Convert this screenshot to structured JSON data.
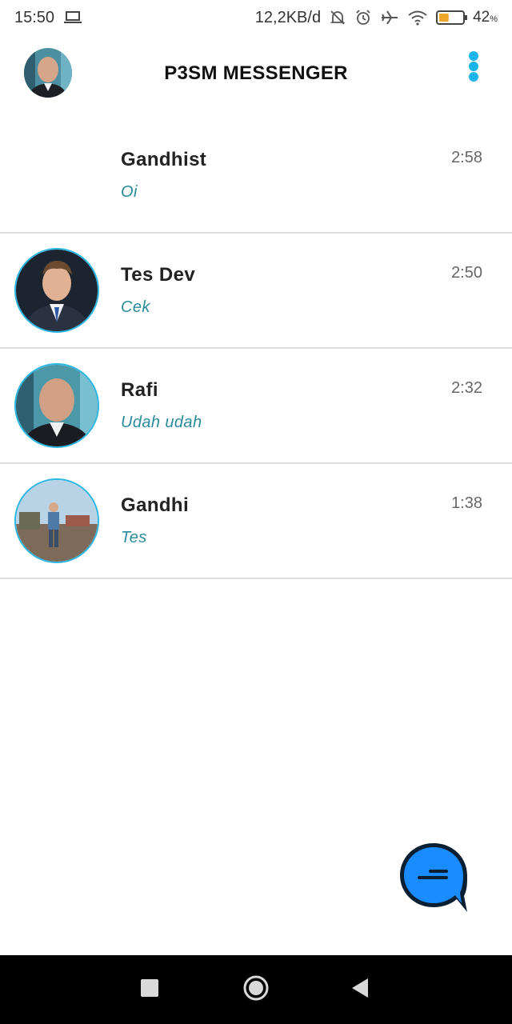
{
  "status_bar": {
    "time": "15:50",
    "network_speed": "12,2KB/d",
    "battery_percent": "42",
    "battery_unit": "%",
    "battery_level": 0.42,
    "icons": [
      "laptop-icon",
      "bell-off-icon",
      "alarm-icon",
      "airplane-icon",
      "wifi-icon",
      "battery-icon"
    ]
  },
  "header": {
    "title": "P3SM MESSENGER",
    "accent_color": "#19b5e8"
  },
  "chats": [
    {
      "name": "Gandhist",
      "preview": "Oi",
      "time": "2:58",
      "has_avatar": false
    },
    {
      "name": "Tes Dev",
      "preview": "Cek",
      "time": "2:50",
      "has_avatar": true
    },
    {
      "name": "Rafi",
      "preview": "Udah udah",
      "time": "2:32",
      "has_avatar": true
    },
    {
      "name": "Gandhi",
      "preview": "Tes",
      "time": "1:38",
      "has_avatar": true
    }
  ],
  "fab": {
    "icon": "new-chat-icon",
    "color": "#1a8cff"
  },
  "nav": {
    "buttons": [
      "recent-apps-icon",
      "home-icon",
      "back-icon"
    ]
  }
}
